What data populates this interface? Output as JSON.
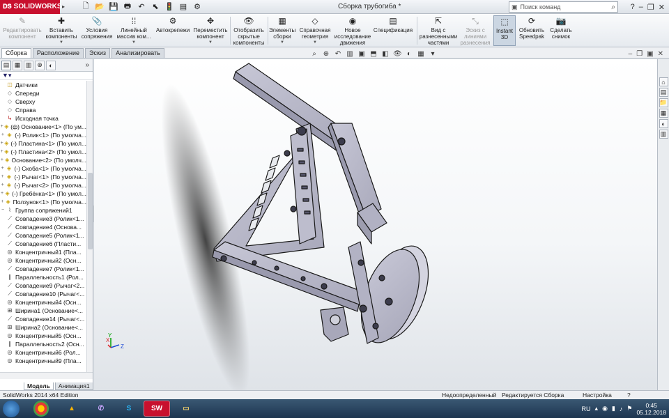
{
  "app": {
    "logo_text": "SOLIDWORKS",
    "doc_title": "Сборка трубогиба *",
    "search_placeholder": "Поиск команд"
  },
  "toolbar": {
    "items": [
      {
        "label": "Редактировать компонент",
        "disabled": true
      },
      {
        "label": "Вставить компоненты"
      },
      {
        "label": "Условия сопряжения"
      },
      {
        "label": "Линейный массив ком..."
      },
      {
        "label": "Автокрепежи"
      },
      {
        "label": "Переместить компонент"
      },
      {
        "label": "Отобразить скрытые компоненты"
      },
      {
        "label": "Элементы сборки"
      },
      {
        "label": "Справочная геометрия"
      },
      {
        "label": "Новое исследование движения"
      },
      {
        "label": "Спецификация"
      },
      {
        "label": "Вид с разнесенными частями"
      },
      {
        "label": "Эскиз с линиями разнесения",
        "disabled": true
      },
      {
        "label": "Instant 3D",
        "active": true
      },
      {
        "label": "Обновить Speedpak"
      },
      {
        "label": "Сделать снимок"
      }
    ]
  },
  "tabs": [
    "Сборка",
    "Расположение",
    "Эскиз",
    "Анализировать"
  ],
  "tree": {
    "items": [
      {
        "exp": "",
        "icon": "◫",
        "cls": "folder",
        "label": "Датчики"
      },
      {
        "exp": "",
        "icon": "◇",
        "cls": "plane",
        "label": "Спереди"
      },
      {
        "exp": "",
        "icon": "◇",
        "cls": "plane",
        "label": "Сверху"
      },
      {
        "exp": "",
        "icon": "◇",
        "cls": "plane",
        "label": "Справа"
      },
      {
        "exp": "",
        "icon": "↳",
        "cls": "origin",
        "label": "Исходная точка"
      },
      {
        "exp": "+",
        "icon": "◈",
        "cls": "part",
        "label": "(ф) Основание<1> (По ум..."
      },
      {
        "exp": "+",
        "icon": "◈",
        "cls": "part",
        "label": "(-) Ролик<1> (По умолча..."
      },
      {
        "exp": "+",
        "icon": "◈",
        "cls": "part",
        "label": "(-) Пластина<1> (По умол..."
      },
      {
        "exp": "+",
        "icon": "◈",
        "cls": "part",
        "label": "(-) Пластина<2> (По умол..."
      },
      {
        "exp": "+",
        "icon": "◈",
        "cls": "part",
        "label": "Основание<2> (По умолч..."
      },
      {
        "exp": "+",
        "icon": "◈",
        "cls": "part",
        "label": "(-) Скоба<1> (По умолча..."
      },
      {
        "exp": "+",
        "icon": "◈",
        "cls": "part",
        "label": "(-) Рычаг<1> (По умолча..."
      },
      {
        "exp": "+",
        "icon": "◈",
        "cls": "part",
        "label": "(-) Рычаг<2> (По умолча..."
      },
      {
        "exp": "+",
        "icon": "◈",
        "cls": "part",
        "label": "(-) Гребёнка<1> (По умол..."
      },
      {
        "exp": "+",
        "icon": "◈",
        "cls": "part",
        "label": "Ползунок<1> (По умолча..."
      },
      {
        "exp": "−",
        "icon": "⌇",
        "cls": "mategrp",
        "label": "Группа сопряжений1"
      },
      {
        "exp": "",
        "icon": "⟋",
        "cls": "mate",
        "label": "Совпадение3 (Ролик<1..."
      },
      {
        "exp": "",
        "icon": "⟋",
        "cls": "mate",
        "label": "Совпадение4 (Основа..."
      },
      {
        "exp": "",
        "icon": "⟋",
        "cls": "mate",
        "label": "Совпадение5 (Ролик<1..."
      },
      {
        "exp": "",
        "icon": "⟋",
        "cls": "mate",
        "label": "Совпадение6 (Пласти..."
      },
      {
        "exp": "",
        "icon": "◎",
        "cls": "mate",
        "label": "Концентричный1 (Пла..."
      },
      {
        "exp": "",
        "icon": "◎",
        "cls": "mate",
        "label": "Концентричный2 (Осн..."
      },
      {
        "exp": "",
        "icon": "⟋",
        "cls": "mate",
        "label": "Совпадение7 (Ролик<1..."
      },
      {
        "exp": "",
        "icon": "∥",
        "cls": "mate",
        "label": "Параллельность1 (Рол..."
      },
      {
        "exp": "",
        "icon": "⟋",
        "cls": "mate",
        "label": "Совпадение9 (Рычаг<2..."
      },
      {
        "exp": "",
        "icon": "⟋",
        "cls": "mate",
        "label": "Совпадение10 (Рычаг<..."
      },
      {
        "exp": "",
        "icon": "◎",
        "cls": "mate",
        "label": "Концентричный4 (Осн..."
      },
      {
        "exp": "",
        "icon": "⊞",
        "cls": "mate",
        "label": "Ширина1 (Основание<..."
      },
      {
        "exp": "",
        "icon": "⟋",
        "cls": "mate",
        "label": "Совпадение14 (Рычаг<..."
      },
      {
        "exp": "",
        "icon": "⊞",
        "cls": "mate",
        "label": "Ширина2 (Основание<..."
      },
      {
        "exp": "",
        "icon": "◎",
        "cls": "mate",
        "label": "Концентричный5 (Осн..."
      },
      {
        "exp": "",
        "icon": "∥",
        "cls": "mate",
        "label": "Параллельность2 (Осн..."
      },
      {
        "exp": "",
        "icon": "◎",
        "cls": "mate",
        "label": "Концентричный6 (Рол..."
      },
      {
        "exp": "",
        "icon": "◎",
        "cls": "mate",
        "label": "Концентричный9 (Пла..."
      }
    ]
  },
  "bottom_tabs": [
    "Модель",
    "Анимация1"
  ],
  "status": {
    "edition": "SolidWorks 2014 x64 Edition",
    "definition": "Недоопределенный",
    "editing": "Редактируется Сборка",
    "settings": "Настройка"
  },
  "triad": {
    "x": "X",
    "y": "Y",
    "z": "Z"
  },
  "taskbar": {
    "sw_label": "SW",
    "lang": "RU",
    "time": "0:45",
    "date": "05.12.2018"
  },
  "colors": {
    "sw_red": "#c8102e",
    "model_fill": "#b8b8c8",
    "model_edge": "#1a1a1a"
  }
}
